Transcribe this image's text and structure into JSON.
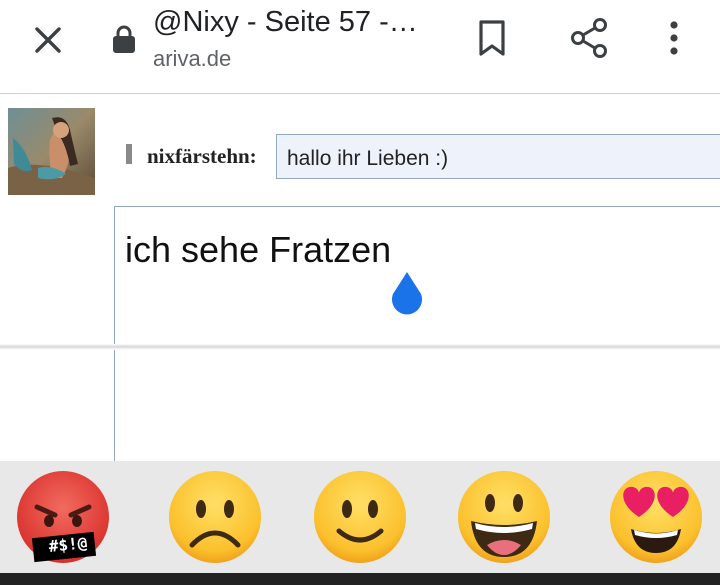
{
  "browser": {
    "tab_title": "@Nixy - Seite 57 -…",
    "domain": "ariva.de"
  },
  "post": {
    "username": "nixfärstehn:",
    "subject_value": "hallo ihr Lieben   :)",
    "message_value": "ich sehe Fratzen"
  },
  "emoji_suggestions": {
    "items": [
      {
        "icon": "angry-cursing-face-icon",
        "symbol_text": "#$!@"
      },
      {
        "icon": "frowning-face-icon"
      },
      {
        "icon": "slightly-smiling-face-icon"
      },
      {
        "icon": "grinning-face-icon"
      },
      {
        "icon": "heart-eyes-face-icon"
      }
    ]
  },
  "colors": {
    "accent_blue": "#1a73e8",
    "input_border": "#93a8c4",
    "input_fill": "#eef3fb",
    "emoji_yellow": "#fbc02d",
    "angry_red": "#e53935"
  }
}
